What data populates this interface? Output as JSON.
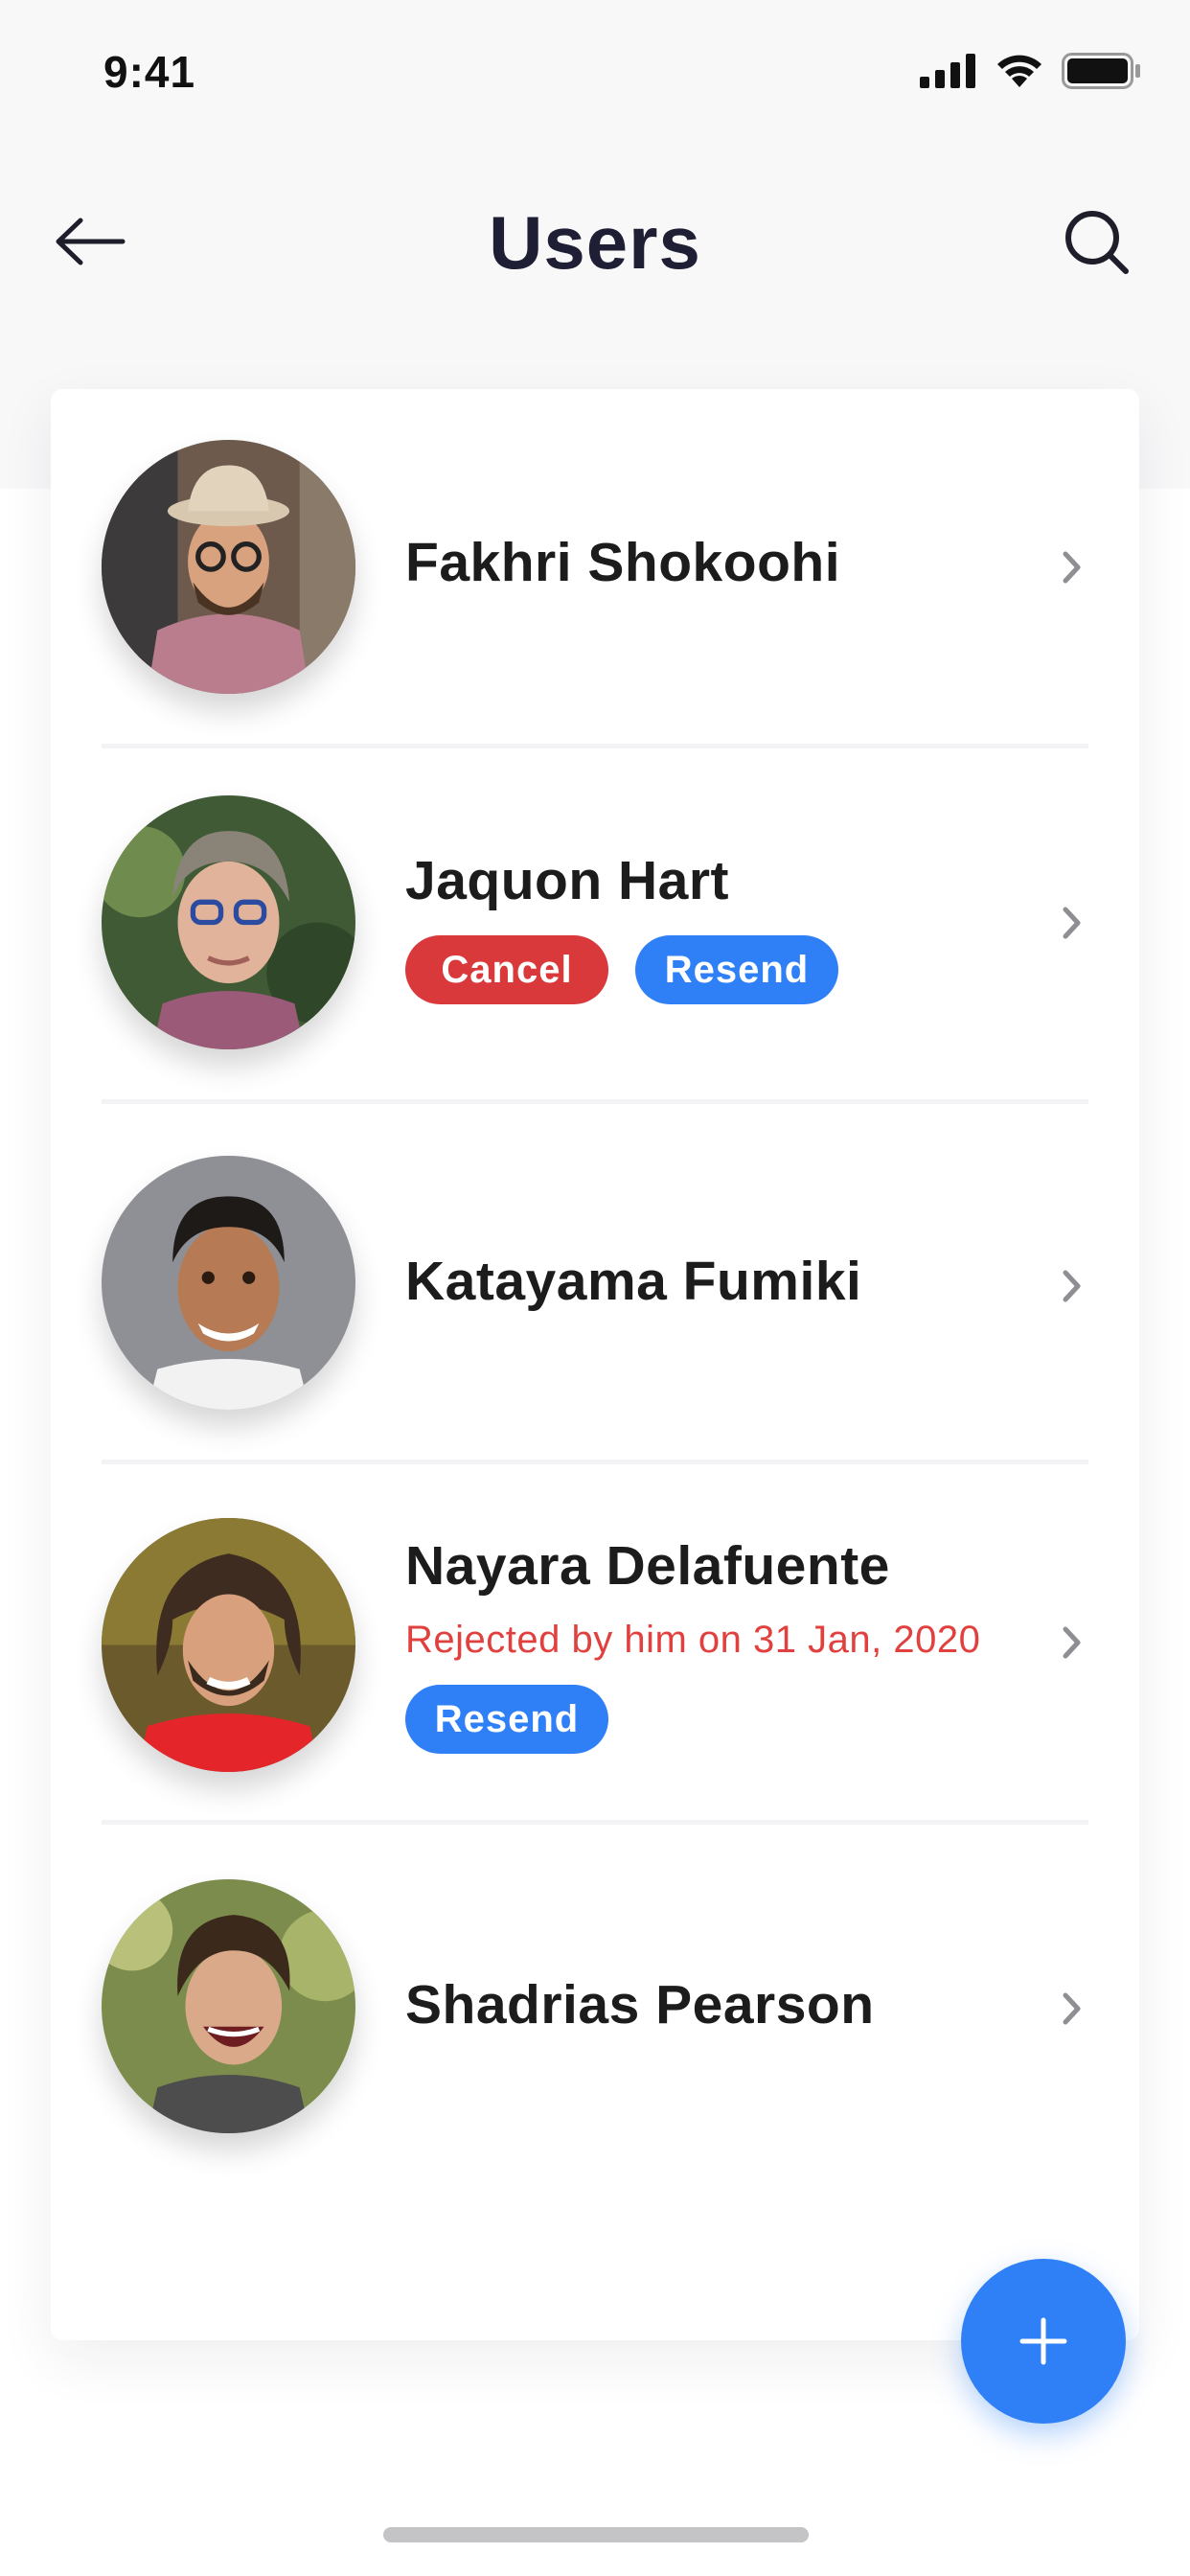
{
  "status_bar": {
    "time": "9:41"
  },
  "header": {
    "title": "Users",
    "back_icon": "arrow-left-icon",
    "search_icon": "search-icon"
  },
  "users": [
    {
      "name": "Fakhri Shokoohi"
    },
    {
      "name": "Jaquon Hart",
      "actions": [
        "Cancel",
        "Resend"
      ]
    },
    {
      "name": "Katayama Fumiki"
    },
    {
      "name": "Nayara Delafuente",
      "note": "Rejected by him on 31 Jan, 2020",
      "actions": [
        "Resend"
      ]
    },
    {
      "name": "Shadrias Pearson"
    }
  ],
  "fab": {
    "icon": "plus-icon"
  },
  "colors": {
    "accent_blue": "#2f80f7",
    "danger_red": "#d9393b",
    "note_red": "#e0413f",
    "title": "#1e1e34"
  }
}
